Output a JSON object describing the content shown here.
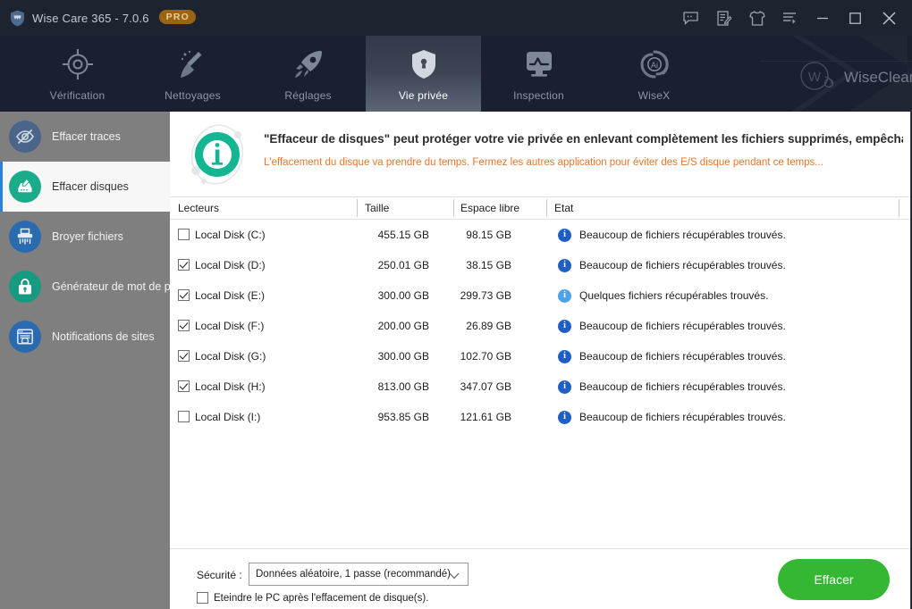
{
  "window": {
    "title": "Wise Care 365 - 7.0.6",
    "badge": "PRO",
    "logo_icon": "shield-icon",
    "controls": [
      {
        "name": "feedback-icon",
        "label": "Feedback"
      },
      {
        "name": "edit-note-icon",
        "label": "Notes"
      },
      {
        "name": "skin-tshirt-icon",
        "label": "Skin"
      },
      {
        "name": "menu-list-icon",
        "label": "Menu"
      },
      {
        "name": "minimize-icon",
        "label": "Minimize"
      },
      {
        "name": "maximize-icon",
        "label": "Maximize"
      },
      {
        "name": "close-icon",
        "label": "Close"
      }
    ]
  },
  "nav": {
    "watermark": "WiseCleaner",
    "tabs": [
      {
        "label": "Vérification",
        "icon": "target-icon",
        "active": false
      },
      {
        "label": "Nettoyages",
        "icon": "broom-icon",
        "active": false
      },
      {
        "label": "Réglages",
        "icon": "rocket-icon",
        "active": false
      },
      {
        "label": "Vie privée",
        "icon": "shield-lock-icon",
        "active": true
      },
      {
        "label": "Inspection",
        "icon": "monitor-icon",
        "active": false
      },
      {
        "label": "WiseX",
        "icon": "ai-spiral-icon",
        "active": false
      }
    ]
  },
  "sidebar": {
    "items": [
      {
        "label": "Effacer traces",
        "icon": "eye-slash-icon",
        "active": false
      },
      {
        "label": "Effacer disques",
        "icon": "disk-eraser-icon",
        "active": true
      },
      {
        "label": "Broyer fichiers",
        "icon": "shredder-icon",
        "active": false
      },
      {
        "label": "Générateur de mot de p...",
        "icon": "password-lock-icon",
        "active": false
      },
      {
        "label": "Notifications de sites",
        "icon": "site-notification-icon",
        "active": false
      }
    ]
  },
  "banner": {
    "icon": "info-circle-icon",
    "title": "\"Effaceur de disques\" peut protéger votre vie privée en enlevant complètement les fichiers supprimés, empêchan",
    "subtitle": "L'effacement du disque va prendre du temps. Fermez les autres application pour éviter des E/S disque pendant ce temps..."
  },
  "table": {
    "columns": [
      "Lecteurs",
      "Taille",
      "Espace libre",
      "Etat"
    ],
    "rows": [
      {
        "checked": false,
        "name": "Local Disk (C:)",
        "size": "455.15 GB",
        "free": "98.15 GB",
        "state": "Beaucoup de fichiers récupérables trouvés.",
        "state_level": "strong"
      },
      {
        "checked": true,
        "name": "Local Disk (D:)",
        "size": "250.01 GB",
        "free": "38.15 GB",
        "state": "Beaucoup de fichiers récupérables trouvés.",
        "state_level": "strong"
      },
      {
        "checked": true,
        "name": "Local Disk (E:)",
        "size": "300.00 GB",
        "free": "299.73 GB",
        "state": "Quelques fichiers récupérables trouvés.",
        "state_level": "light"
      },
      {
        "checked": true,
        "name": "Local Disk (F:)",
        "size": "200.00 GB",
        "free": "26.89 GB",
        "state": "Beaucoup de fichiers récupérables trouvés.",
        "state_level": "strong"
      },
      {
        "checked": true,
        "name": "Local Disk (G:)",
        "size": "300.00 GB",
        "free": "102.70 GB",
        "state": "Beaucoup de fichiers récupérables trouvés.",
        "state_level": "strong"
      },
      {
        "checked": true,
        "name": "Local Disk (H:)",
        "size": "813.00 GB",
        "free": "347.07 GB",
        "state": "Beaucoup de fichiers récupérables trouvés.",
        "state_level": "strong"
      },
      {
        "checked": false,
        "name": "Local Disk (I:)",
        "size": "953.85 GB",
        "free": "121.61 GB",
        "state": "Beaucoup de fichiers récupérables trouvés.",
        "state_level": "strong"
      }
    ]
  },
  "footer": {
    "security_label": "Sécurité :",
    "security_value": "Données aléatoire, 1 passe (recommandé)",
    "shutdown_label": "Eteindre le PC après l'effacement de disque(s).",
    "shutdown_checked": false,
    "erase_button": "Effacer"
  },
  "colors": {
    "titlebar": "#1e2330",
    "navbar": "#1b2030",
    "sidebar": "#7f7f7f",
    "accent_blue": "#2b83e0",
    "accent_teal": "#1aab8a",
    "warning_orange": "#e8762c",
    "erase_green": "#35b734",
    "pro_badge": "#9a6512",
    "state_strong_blue": "#1f5fc4",
    "state_light_blue": "#4ea2e8"
  }
}
